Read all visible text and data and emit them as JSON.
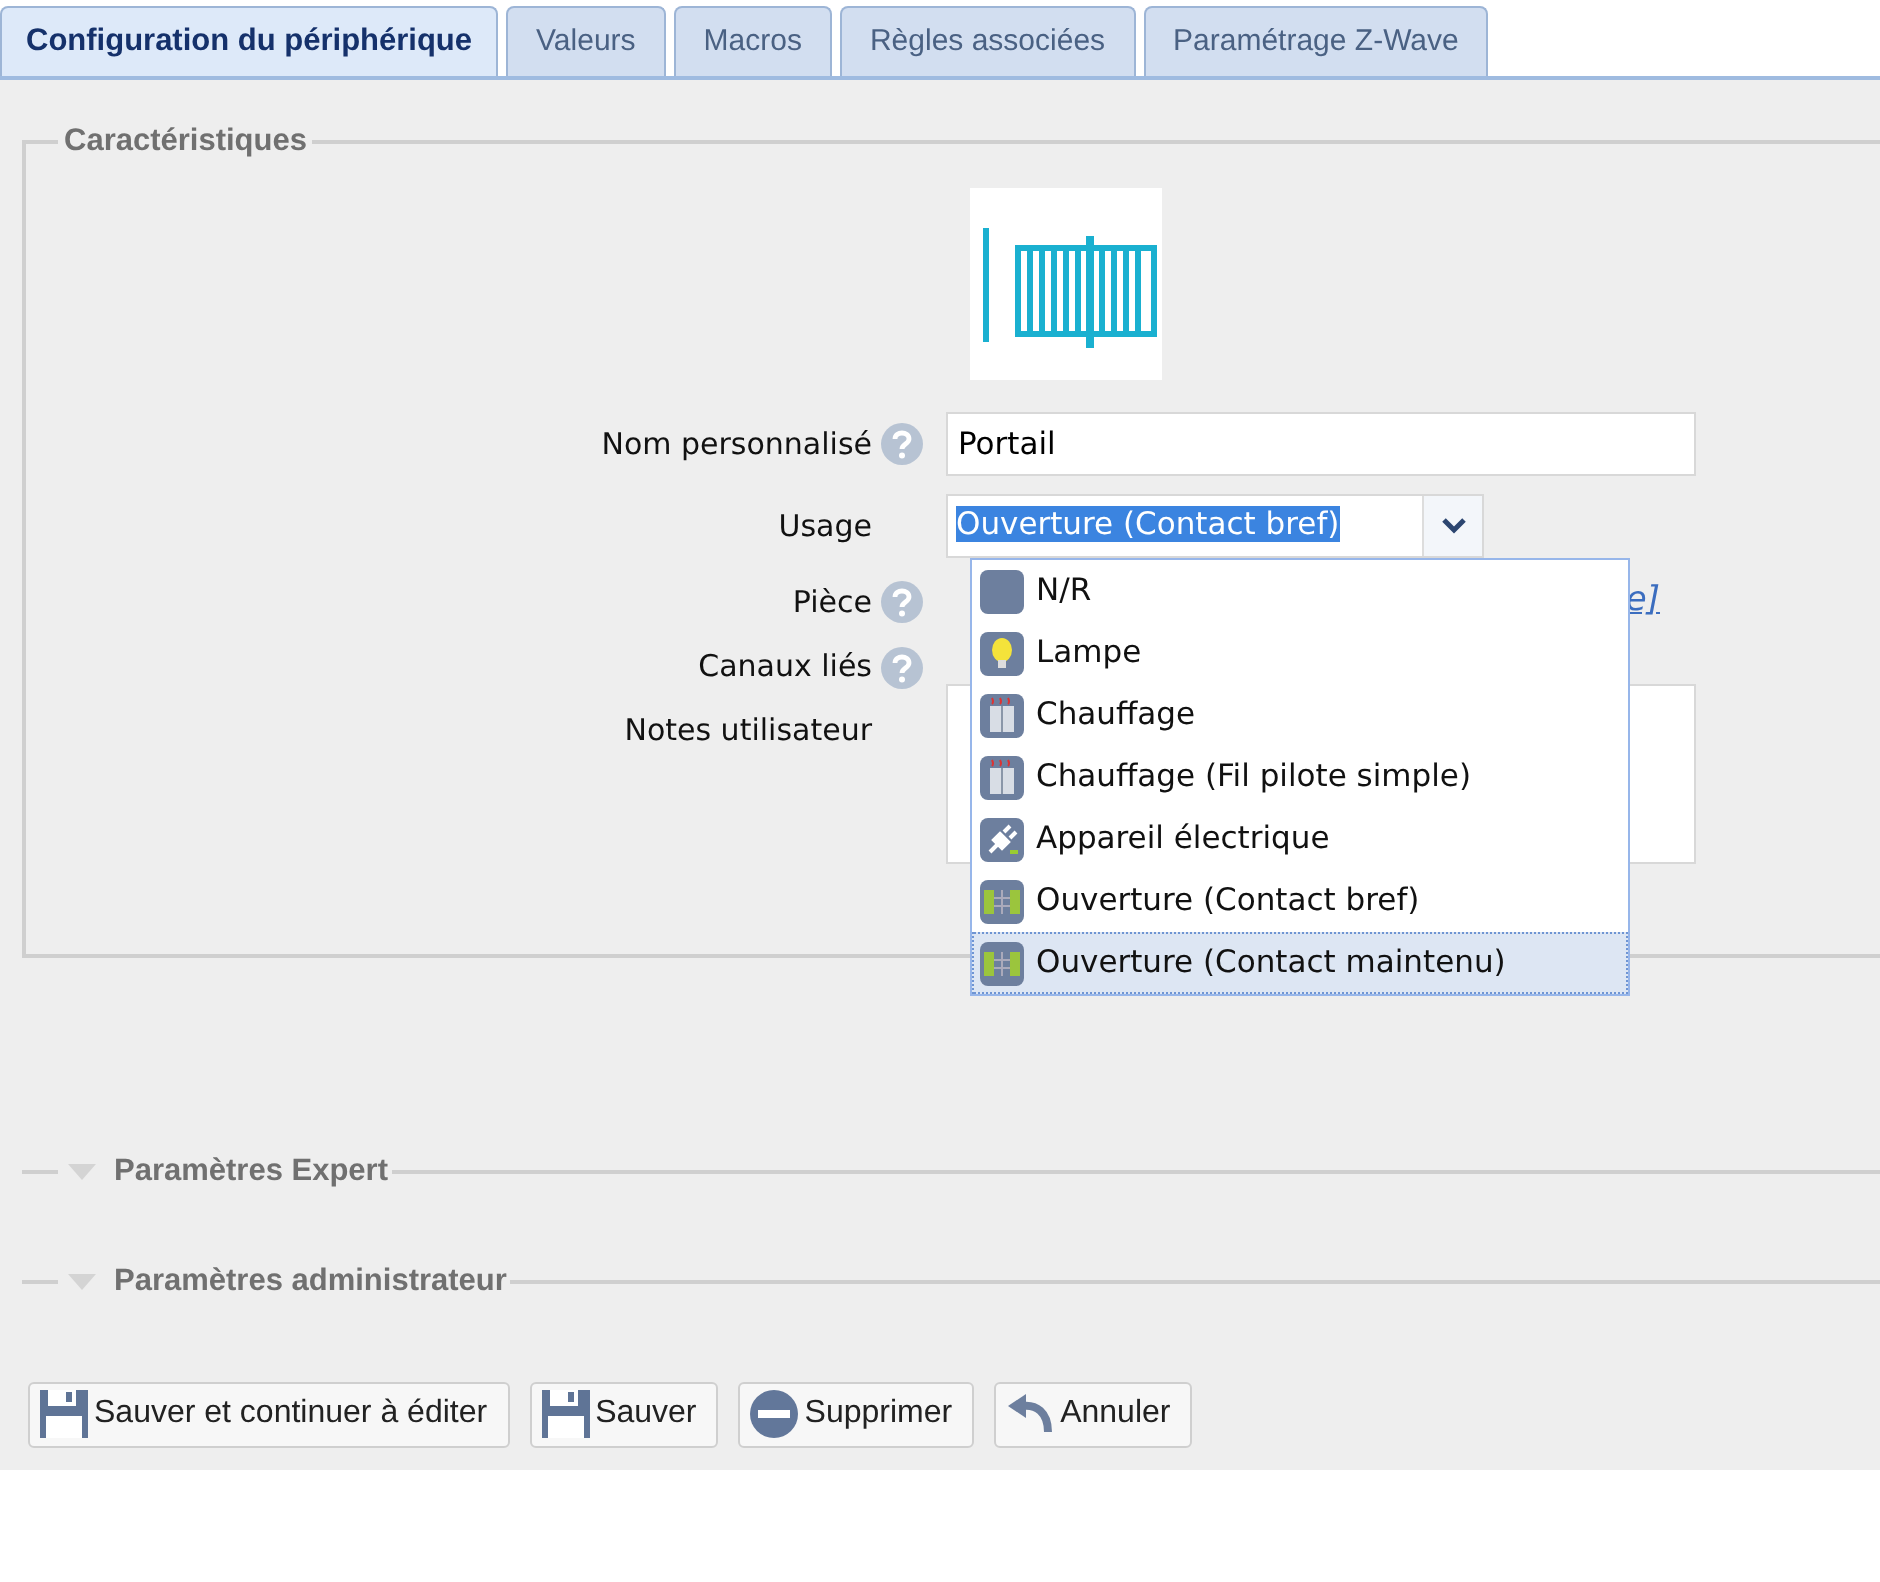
{
  "tabs": [
    {
      "label": "Configuration du périphérique",
      "selected": true
    },
    {
      "label": "Valeurs",
      "selected": false
    },
    {
      "label": "Macros",
      "selected": false
    },
    {
      "label": "Règles associées",
      "selected": false
    },
    {
      "label": "Paramétrage Z-Wave",
      "selected": false
    }
  ],
  "characteristics": {
    "legend": "Caractéristiques",
    "fields": [
      {
        "kind": "text",
        "label": "Nom personnalisé",
        "help": true,
        "value": "Portail"
      },
      {
        "kind": "select",
        "label": "Usage",
        "help": false,
        "value": "Ouverture (Contact bref)"
      },
      {
        "kind": "link",
        "label": "Pièce",
        "help": true,
        "link_text": "e]"
      },
      {
        "kind": "empty",
        "label": "Canaux liés",
        "help": true
      },
      {
        "kind": "textarea",
        "label": "Notes utilisateur",
        "help": false
      }
    ],
    "dropdown": [
      {
        "kind": "none",
        "label": "N/R",
        "highlighted": false
      },
      {
        "kind": "lamp",
        "label": "Lampe",
        "highlighted": false
      },
      {
        "kind": "heater",
        "label": "Chauffage",
        "highlighted": false
      },
      {
        "kind": "heater",
        "label": "Chauffage (Fil pilote simple)",
        "highlighted": false
      },
      {
        "kind": "plug",
        "label": "Appareil électrique",
        "highlighted": false
      },
      {
        "kind": "opening",
        "label": "Ouverture (Contact bref)",
        "highlighted": false
      },
      {
        "kind": "opening",
        "label": "Ouverture (Contact maintenu)",
        "highlighted": true
      }
    ]
  },
  "sections": [
    {
      "label": "Paramètres Expert",
      "expanded": false
    },
    {
      "label": "Paramètres administrateur",
      "expanded": false
    }
  ],
  "buttons": [
    {
      "kind": "save",
      "label": "Sauver et continuer à éditer"
    },
    {
      "kind": "save",
      "label": "Sauver"
    },
    {
      "kind": "delete",
      "label": "Supprimer"
    },
    {
      "kind": "undo",
      "label": "Annuler"
    }
  ]
}
